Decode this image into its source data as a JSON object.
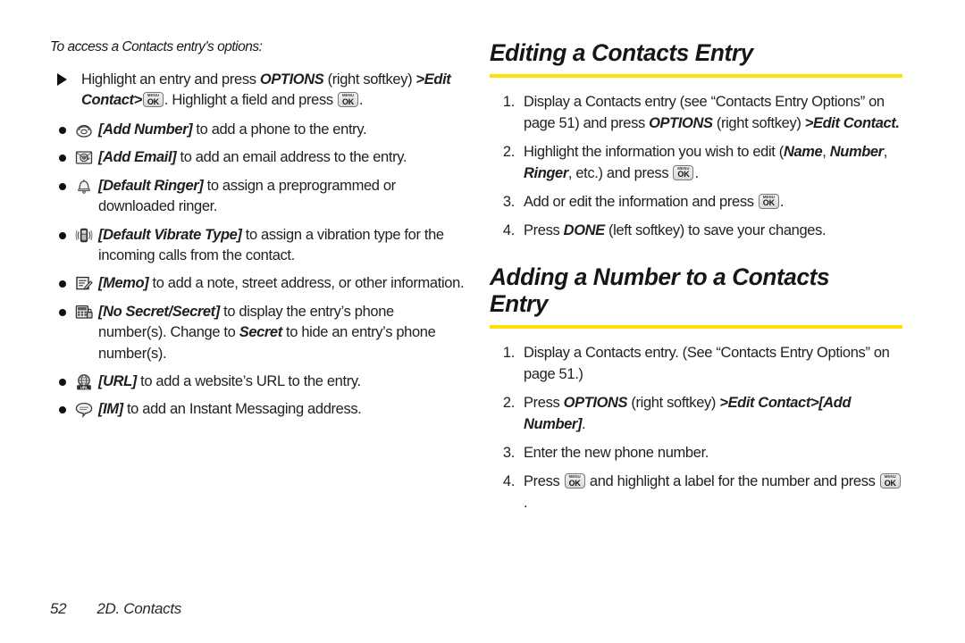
{
  "page": {
    "number": "52",
    "chapter": "2D. Contacts"
  },
  "accent_color": "#FFE000",
  "left_column": {
    "subhead": "To access a Contacts entry’s options:",
    "arrow_item": {
      "p1": "Highlight an entry and press ",
      "options": "OPTIONS",
      "p2": " (right softkey) ",
      "gt1": ">",
      "edit_contact": "Edit Contact",
      "gt2": ">",
      "p3": ". Highlight a field and press ",
      "p4": "."
    },
    "bullets": [
      {
        "icon": "telephone-icon",
        "label": "[Add Number]",
        "text": " to add a phone to the entry."
      },
      {
        "icon": "email-at-icon",
        "label": "[Add Email]",
        "text": " to add an email address to the entry."
      },
      {
        "icon": "bell-ringer-icon",
        "label": "[Default Ringer]",
        "text": " to assign a preprogrammed or downloaded ringer."
      },
      {
        "icon": "vibrating-phone-icon",
        "label": "[Default Vibrate Type]",
        "text": " to assign a vibration type for the incoming calls from the contact."
      },
      {
        "icon": "memo-pencil-icon",
        "label": "[Memo]",
        "text": " to add a note, street address, or other information."
      },
      {
        "icon": "secret-keypad-icon",
        "label": "[No Secret/Secret]",
        "text_a": " to display the entry’s phone number(s). Change to ",
        "secret": "Secret",
        "text_b": " to hide an entry’s phone number(s)."
      },
      {
        "icon": "url-globe-icon",
        "label": "[URL]",
        "text": " to add a website’s URL to the entry."
      },
      {
        "icon": "im-bubble-icon",
        "label": "[IM]",
        "text": " to add an Instant Messaging address."
      }
    ]
  },
  "right_column": {
    "section1": {
      "title": "Editing a Contacts Entry",
      "steps": [
        {
          "num": "1.",
          "p1": "Display a Contacts entry (see “Contacts Entry Options” on page 51) and press ",
          "options": "OPTIONS",
          "p2": " (right softkey) ",
          "gt": ">",
          "edit_contact": "Edit Contact.",
          "p3": ""
        },
        {
          "num": "2.",
          "p1": "Highlight the information you wish to edit (",
          "name": "Name",
          "sep1": ", ",
          "number": "Number",
          "sep2": ", ",
          "ringer": "Ringer",
          "p2": ", etc.) and press ",
          "p3": "."
        },
        {
          "num": "3.",
          "p1": "Add or edit the information and press ",
          "p2": "."
        },
        {
          "num": "4.",
          "p1": "Press ",
          "done": "DONE",
          "p2": " (left softkey) to save your changes."
        }
      ]
    },
    "section2": {
      "title": "Adding a Number to a Contacts Entry",
      "steps": [
        {
          "num": "1.",
          "p1": "Display a Contacts entry. (See “Contacts Entry Options” on page 51.)"
        },
        {
          "num": "2.",
          "p1": "Press ",
          "options": "OPTIONS",
          "p2": " (right softkey) ",
          "gt1": ">",
          "edit_contact": "Edit Contact",
          "gt2": ">",
          "add_number": "[Add Number]",
          "p3": "."
        },
        {
          "num": "3.",
          "p1": "Enter the new phone number."
        },
        {
          "num": "4.",
          "p1": "Press ",
          "p2": " and highlight a label for the number and press ",
          "p3": "."
        }
      ]
    }
  },
  "key_glyph": {
    "top": "MENU",
    "bottom": "OK"
  }
}
